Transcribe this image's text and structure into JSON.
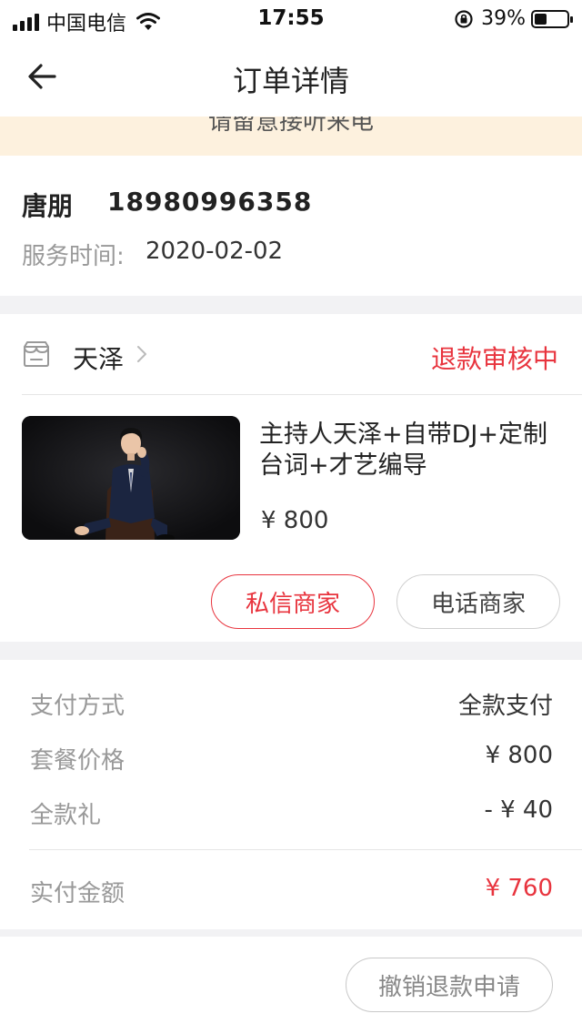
{
  "status_bar": {
    "carrier": "中国电信",
    "time": "17:55",
    "battery": "39%",
    "battery_level": 0.39
  },
  "nav": {
    "title": "订单详情",
    "back_icon": "arrow-left-icon"
  },
  "notice": {
    "text": "请留意接听来电"
  },
  "customer": {
    "name": "唐朋",
    "phone": "18980996358",
    "service_time_label": "服务时间:",
    "service_time": "2020-02-02"
  },
  "order": {
    "shop_icon": "store-icon",
    "shop_name": "天泽",
    "status": "退款审核中",
    "package_title": "主持人天泽+自带DJ+定制台词+才艺编导",
    "package_price": "¥ 800",
    "message_button": "私信商家",
    "call_button": "电话商家"
  },
  "payment": {
    "rows": [
      {
        "label": "支付方式",
        "value": "全款支付"
      },
      {
        "label": "套餐价格",
        "value": "¥ 800"
      },
      {
        "label": "全款礼",
        "value": "- ¥ 40"
      }
    ],
    "total_label": "实付金额",
    "total_value": "¥ 760"
  },
  "footer": {
    "cancel_refund_button": "撤销退款申请"
  },
  "colors": {
    "accent_red": "#e8343e",
    "notice_bg": "#fdf1de",
    "page_bg": "#f2f2f4"
  }
}
